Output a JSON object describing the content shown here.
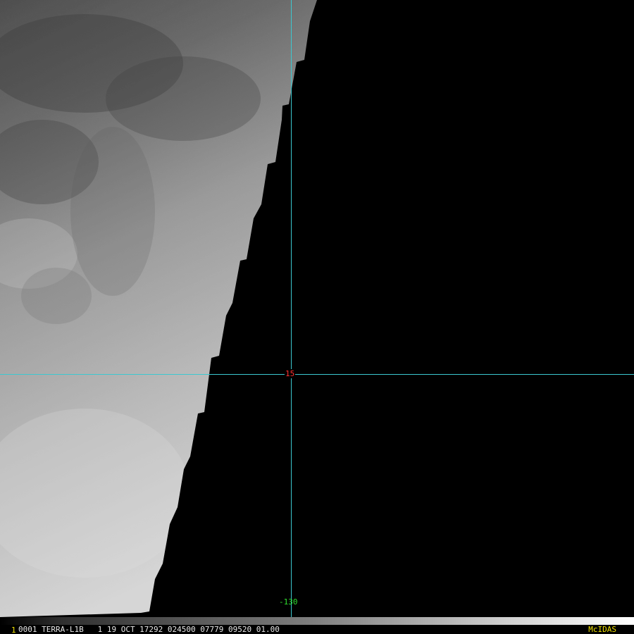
{
  "colors": {
    "grid": "#3cc8d0",
    "lat_label": "#ff3030",
    "lon_label": "#30e030",
    "frame_number": "#f0e000",
    "brand": "#f0e000",
    "info_text": "#e8e8e8"
  },
  "map": {
    "latitude_label": "15",
    "longitude_label": "-130"
  },
  "status_bar": {
    "frame_number": "1",
    "frame_info": "0001 TERRA-L1B   1 19 OCT 17292 024500 07779 09520 01.00",
    "brand": "McIDAS"
  }
}
